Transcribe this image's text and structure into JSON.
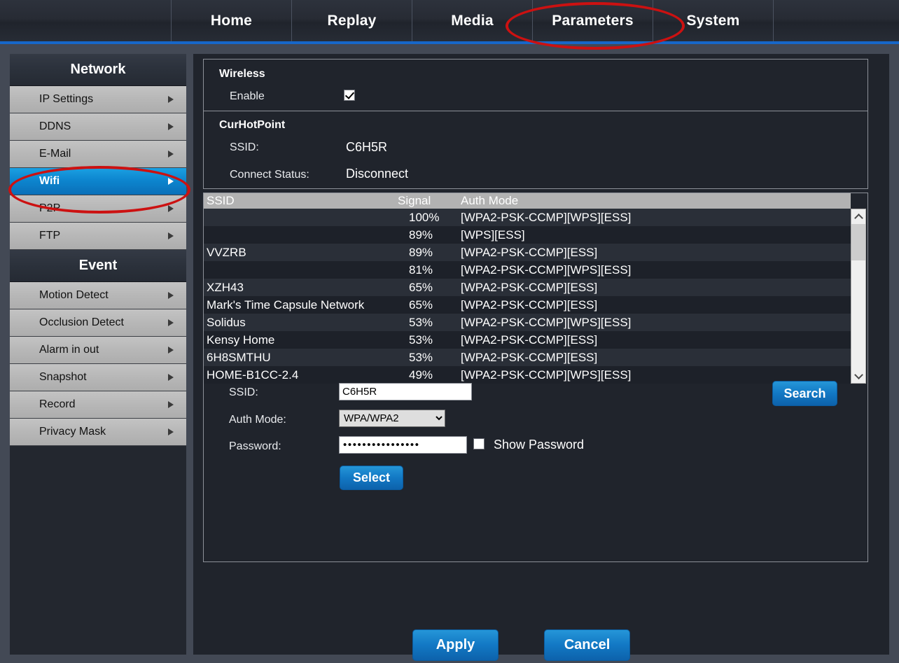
{
  "nav": {
    "tabs": [
      {
        "id": "home",
        "label": "Home"
      },
      {
        "id": "replay",
        "label": "Replay"
      },
      {
        "id": "media",
        "label": "Media"
      },
      {
        "id": "parameters",
        "label": "Parameters"
      },
      {
        "id": "system",
        "label": "System"
      }
    ],
    "active": "Parameters"
  },
  "sidebar": {
    "groups": [
      {
        "title": "Network",
        "items": [
          {
            "label": "IP Settings",
            "active": false
          },
          {
            "label": "DDNS",
            "active": false
          },
          {
            "label": "E-Mail",
            "active": false
          },
          {
            "label": "Wifi",
            "active": true
          },
          {
            "label": "P2P",
            "active": false
          },
          {
            "label": "FTP",
            "active": false
          }
        ]
      },
      {
        "title": "Event",
        "items": [
          {
            "label": "Motion Detect",
            "active": false
          },
          {
            "label": "Occlusion Detect",
            "active": false
          },
          {
            "label": "Alarm in out",
            "active": false
          },
          {
            "label": "Snapshot",
            "active": false
          },
          {
            "label": "Record",
            "active": false
          },
          {
            "label": "Privacy Mask",
            "active": false
          }
        ]
      }
    ]
  },
  "wireless": {
    "title": "Wireless",
    "enable_label": "Enable",
    "enable_checked": true
  },
  "hotpoint": {
    "title": "CurHotPoint",
    "ssid_label": "SSID:",
    "ssid_value": "C6H5R",
    "status_label": "Connect Status:",
    "status_value": "Disconnect"
  },
  "network_list": {
    "columns": [
      "SSID",
      "Signal",
      "Auth Mode"
    ],
    "rows": [
      {
        "ssid": "",
        "signal": "100%",
        "auth": "[WPA2-PSK-CCMP][WPS][ESS]"
      },
      {
        "ssid": "",
        "signal": "89%",
        "auth": "[WPS][ESS]"
      },
      {
        "ssid": "VVZRB",
        "signal": "89%",
        "auth": "[WPA2-PSK-CCMP][ESS]"
      },
      {
        "ssid": "",
        "signal": "81%",
        "auth": "[WPA2-PSK-CCMP][WPS][ESS]"
      },
      {
        "ssid": "XZH43",
        "signal": "65%",
        "auth": "[WPA2-PSK-CCMP][ESS]"
      },
      {
        "ssid": "Mark's Time Capsule Network",
        "signal": "65%",
        "auth": "[WPA2-PSK-CCMP][ESS]"
      },
      {
        "ssid": "Solidus",
        "signal": "53%",
        "auth": "[WPA2-PSK-CCMP][WPS][ESS]"
      },
      {
        "ssid": "Kensy Home",
        "signal": "53%",
        "auth": "[WPA2-PSK-CCMP][ESS]"
      },
      {
        "ssid": "6H8SMTHU",
        "signal": "53%",
        "auth": "[WPA2-PSK-CCMP][ESS]"
      },
      {
        "ssid": "HOME-B1CC-2.4",
        "signal": "49%",
        "auth": "[WPA2-PSK-CCMP][WPS][ESS]"
      }
    ]
  },
  "form": {
    "ssid_label": "SSID:",
    "ssid_value": "C6H5R",
    "auth_label": "Auth Mode:",
    "auth_value": "WPA/WPA2",
    "auth_options": [
      "WPA/WPA2"
    ],
    "password_label": "Password:",
    "password_masked": "••••••••••••••••",
    "show_password_label": "Show Password",
    "show_password_checked": false,
    "search_label": "Search",
    "select_label": "Select"
  },
  "footer": {
    "apply_label": "Apply",
    "cancel_label": "Cancel"
  },
  "colors": {
    "accent_blue": "#1278c4",
    "nav_underline": "#1767c8",
    "annotation_red": "#cc1111",
    "active_item": "#0d86cf"
  }
}
